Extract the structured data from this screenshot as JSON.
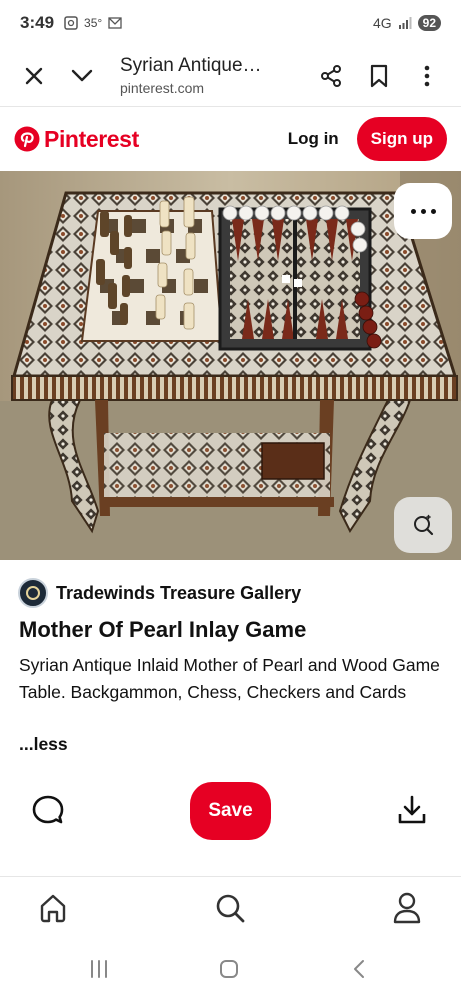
{
  "status_bar": {
    "time": "3:49",
    "temperature": "35°",
    "network": "4G",
    "battery": "92"
  },
  "browser": {
    "title": "Syrian Antique…",
    "url": "pinterest.com",
    "icons": [
      "close-icon",
      "chevron-down-icon",
      "share-icon",
      "bookmark-icon",
      "more-vertical-icon"
    ]
  },
  "header": {
    "logo_text": "Pinterest",
    "login_label": "Log in",
    "signup_label": "Sign up",
    "brand_color": "#e60023"
  },
  "pin": {
    "creator_name": "Tradewinds Treasure Gallery",
    "title": "Mother Of Pearl Inlay Game",
    "description": "Syrian Antique Inlaid Mother of Pearl and Wood Game Table. Backgammon, Chess, Checkers and Cards",
    "less_label": "...less"
  },
  "actions": {
    "save_label": "Save",
    "icons": [
      "comment-icon",
      "download-icon"
    ]
  },
  "bottom_nav": {
    "items": [
      "home-icon",
      "search-icon",
      "profile-icon"
    ]
  }
}
